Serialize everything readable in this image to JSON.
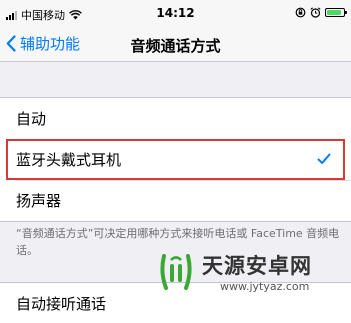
{
  "status_bar": {
    "carrier": "中国移动",
    "time": "14:12",
    "battery_level": 0.85,
    "icons": [
      "signal-icon",
      "wifi-icon",
      "lock-rotation-icon",
      "alarm-icon",
      "battery-icon"
    ]
  },
  "nav": {
    "back_label": "辅助功能",
    "title": "音频通话方式"
  },
  "options": [
    {
      "label": "自动",
      "selected": false
    },
    {
      "label": "蓝牙头戴式耳机",
      "selected": true
    },
    {
      "label": "扬声器",
      "selected": false
    }
  ],
  "footer_note": "“音频通话方式”可决定用哪种方式来接听电话或 FaceTime 音频电话。",
  "next_section": {
    "item_label": "自动接听通话"
  },
  "watermark": {
    "title": "天源安卓网",
    "url": "www.jytyaz.com"
  },
  "colors": {
    "accent": "#007aff",
    "highlight_border": "#d53a35",
    "group_background": "#efeff4"
  }
}
